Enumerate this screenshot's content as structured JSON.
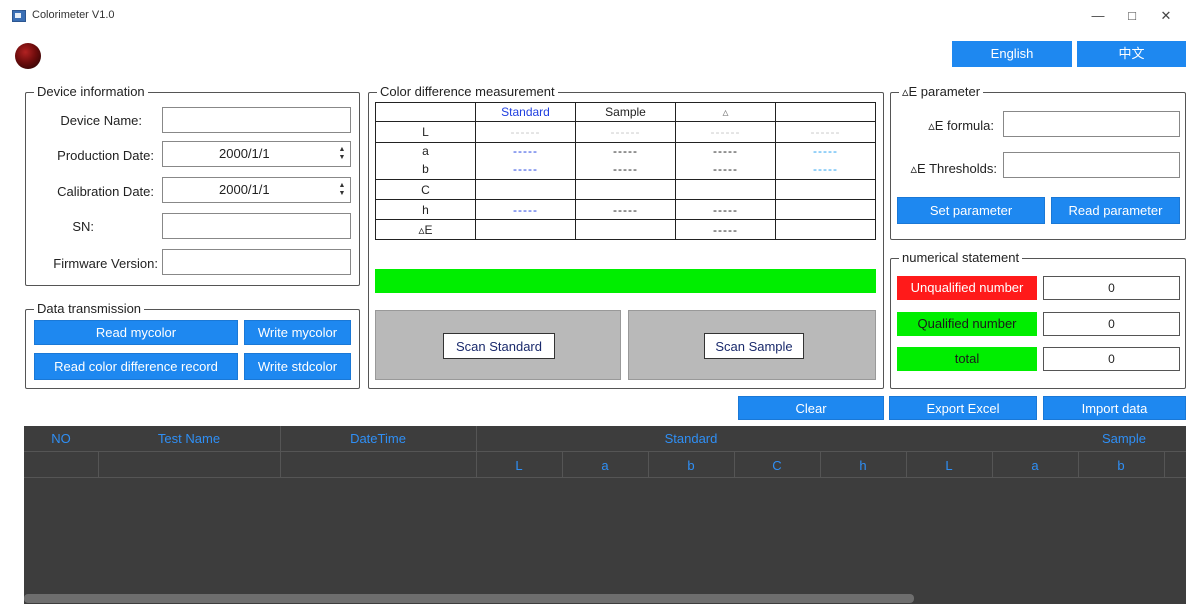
{
  "window": {
    "title": "Colorimeter V1.0",
    "minimize": "—",
    "maximize": "□",
    "close": "✕"
  },
  "language": {
    "english": "English",
    "chinese": "中文"
  },
  "device_info": {
    "legend": "Device information",
    "device_name_label": "Device Name:",
    "device_name_value": "",
    "production_date_label": "Production Date:",
    "production_date_value": "2000/1/1",
    "calibration_date_label": "Calibration Date:",
    "calibration_date_value": "2000/1/1",
    "sn_label": "SN:",
    "sn_value": "",
    "firmware_label": "Firmware Version:",
    "firmware_value": ""
  },
  "data_transmission": {
    "legend": "Data transmission",
    "read_mycolor": "Read mycolor",
    "write_mycolor": "Write mycolor",
    "read_record": "Read color difference record",
    "write_stdcolor": "Write stdcolor"
  },
  "measurement": {
    "legend": "Color difference measurement",
    "headers": [
      "",
      "Standard",
      "Sample",
      "▵",
      ""
    ],
    "rows": [
      {
        "label": "L",
        "cells": [
          "------",
          "------",
          "------",
          "------"
        ]
      },
      {
        "label": "a",
        "cells": [
          "-----",
          "-----",
          "-----",
          "-----"
        ]
      },
      {
        "label": "b",
        "cells": [
          "-----",
          "-----",
          "-----",
          "-----"
        ]
      },
      {
        "label": "C",
        "cells": [
          "",
          "",
          "",
          ""
        ]
      },
      {
        "label": "h",
        "cells": [
          "-----",
          "-----",
          "-----",
          ""
        ]
      },
      {
        "label": "▵E",
        "cells": [
          "",
          "",
          "-----",
          ""
        ]
      }
    ],
    "scan_standard": "Scan Standard",
    "scan_sample": "Scan Sample"
  },
  "de_parameter": {
    "legend": "▵E parameter",
    "formula_label": "▵E formula:",
    "formula_value": "",
    "threshold_label": "▵E Thresholds:",
    "threshold_value": "",
    "set_button": "Set parameter",
    "read_button": "Read parameter"
  },
  "numerical": {
    "legend": "numerical statement",
    "unqualified_label": "Unqualified number",
    "unqualified_value": "0",
    "qualified_label": "Qualified number",
    "qualified_value": "0",
    "total_label": "total",
    "total_value": "0"
  },
  "actions": {
    "clear": "Clear",
    "export": "Export Excel",
    "import": "Import data"
  },
  "grid": {
    "headers": {
      "no": "NO",
      "test_name": "Test Name",
      "datetime": "DateTime",
      "standard": "Standard",
      "sample": "Sample"
    },
    "sub_headers": [
      "L",
      "a",
      "b",
      "C",
      "h",
      "L",
      "a",
      "b"
    ]
  },
  "colors": {
    "accent_blue": "#1e88f0",
    "status_green": "#00ee00",
    "unqualified_red": "#ff1a1a",
    "grid_bg": "#3d3d3d"
  }
}
